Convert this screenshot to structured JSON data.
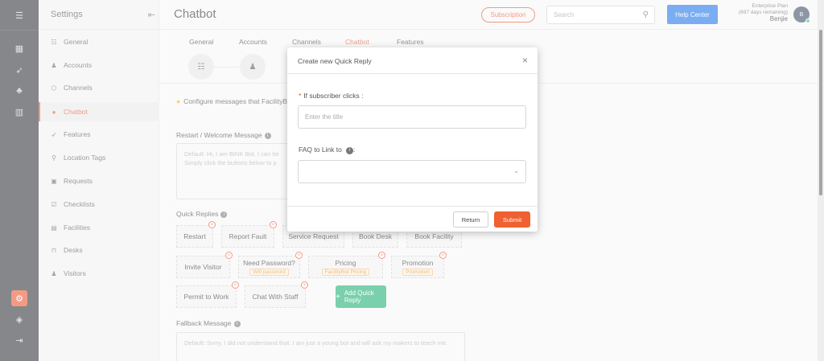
{
  "sidebar": {
    "title": "Settings",
    "items": [
      {
        "label": "General",
        "icon": "sliders-icon"
      },
      {
        "label": "Accounts",
        "icon": "users-icon"
      },
      {
        "label": "Channels",
        "icon": "cube-icon"
      },
      {
        "label": "Chatbot",
        "icon": "chat-bubble-icon",
        "active": true
      },
      {
        "label": "Features",
        "icon": "rocket-icon"
      },
      {
        "label": "Location Tags",
        "icon": "location-pin-icon"
      },
      {
        "label": "Requests",
        "icon": "request-icon"
      },
      {
        "label": "Checklists",
        "icon": "checklist-icon"
      },
      {
        "label": "Facilities",
        "icon": "calendar-icon"
      },
      {
        "label": "Desks",
        "icon": "desk-icon"
      },
      {
        "label": "Visitors",
        "icon": "visitor-icon"
      }
    ]
  },
  "header": {
    "title": "Chatbot",
    "subscription_label": "Subscription",
    "search_placeholder": "Search",
    "help_label": "Help Center",
    "plan_name": "Enterprise Plan",
    "plan_remaining": "(697 days remaining)",
    "user_name": "Benjie",
    "avatar_initial": "B"
  },
  "tabs": [
    "General",
    "Accounts",
    "Channels",
    "Chatbot",
    "Features"
  ],
  "content": {
    "configure_note": "Configure messages that FacilityB",
    "welcome_label": "Restart / Welcome Message",
    "welcome_text": "Default: Hi, I am BINK Bot, I can he",
    "welcome_text2": "Simply click the buttons below to p",
    "quick_replies_label": "Quick Replies",
    "quick_replies": [
      {
        "label": "Restart"
      },
      {
        "label": "Report Fault"
      },
      {
        "label": "Service Request"
      },
      {
        "label": "Book Desk"
      },
      {
        "label": "Book Facility"
      },
      {
        "label": "Invite Visitor"
      },
      {
        "label": "Need Password?",
        "tag": "Wifi password"
      },
      {
        "label": "Pricing",
        "tag": "FacilityBot Pricing"
      },
      {
        "label": "Promotion",
        "tag": "Promotion"
      },
      {
        "label": "Permit to Work"
      },
      {
        "label": "Chat With Staff"
      }
    ],
    "add_quick_reply_label": "Add Quick Reply",
    "fallback_label": "Fallback Message",
    "fallback_text": "Default: Sorry, I did not understand that. I am just a young bot and will ask my makers to teach me."
  },
  "modal": {
    "title": "Create new Quick Reply",
    "close": "×",
    "subscriber_label": "If subscriber clicks :",
    "title_placeholder": "Enter the title",
    "faq_label": "FAQ to Link to",
    "faq_colon": ":",
    "return_label": "Return",
    "submit_label": "Submit"
  },
  "colors": {
    "accent": "#e8532b",
    "help": "#1a73e8",
    "add": "#1aae6f"
  }
}
